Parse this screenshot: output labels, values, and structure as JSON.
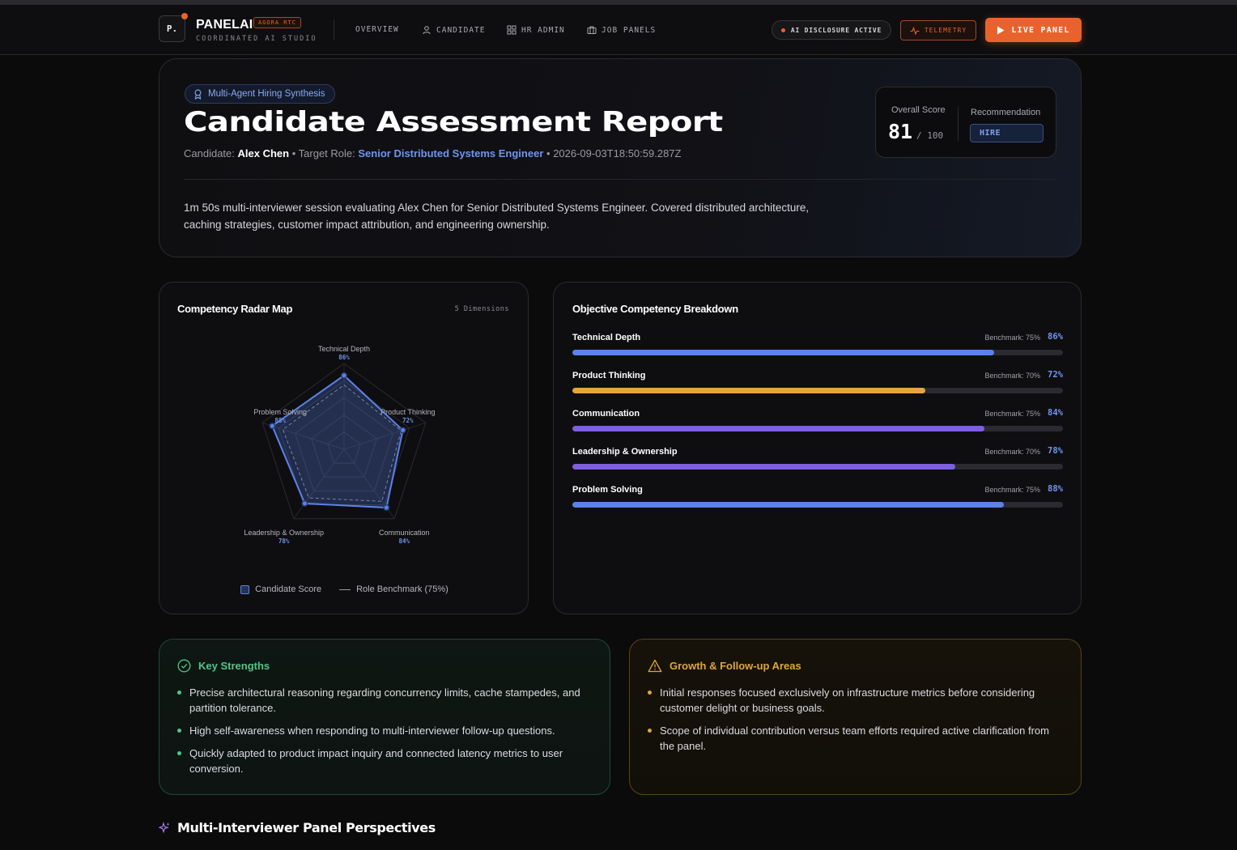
{
  "nav": {
    "logo": "P.",
    "brand": "PANELAI",
    "brand_badge": "AGORA RTC",
    "brand_sub": "COORDINATED AI STUDIO",
    "links": [
      "OVERVIEW",
      "CANDIDATE",
      "HR ADMIN",
      "JOB PANELS"
    ],
    "disclosure": "AI DISCLOSURE ACTIVE",
    "telemetry": "TELEMETRY",
    "live_panel": "LIVE PANEL",
    "accent": "#e8632c"
  },
  "hero": {
    "tag": "Multi-Agent Hiring Synthesis",
    "title": "Candidate Assessment Report",
    "candidate_label": "Candidate:",
    "candidate": "Alex Chen",
    "role_label": "Target Role:",
    "role": "Senior Distributed Systems Engineer",
    "timestamp": "2026-09-03T18:50:59.287Z",
    "summary": "1m 50s multi-interviewer session evaluating Alex Chen for Senior Distributed Systems Engineer. Covered distributed architecture, caching strategies, customer impact attribution, and engineering ownership.",
    "overall_score_label": "Overall Score",
    "overall_score": "81",
    "overall_score_max": "/ 100",
    "recommendation_label": "Recommendation",
    "recommendation": "HIRE"
  },
  "radar": {
    "title": "Competency Radar Map",
    "dimensions_label": "5 Dimensions",
    "legend_candidate": "Candidate Score",
    "legend_benchmark": "Role Benchmark (75%)"
  },
  "chart_data": {
    "type": "radar",
    "categories": [
      "Technical Depth",
      "Product Thinking",
      "Communication",
      "Leadership & Ownership",
      "Problem Solving"
    ],
    "series": [
      {
        "name": "Candidate Score",
        "values": [
          86,
          72,
          84,
          78,
          88
        ]
      },
      {
        "name": "Role Benchmark (75%)",
        "values": [
          75,
          70,
          75,
          70,
          75
        ]
      }
    ],
    "range": [
      0,
      100
    ]
  },
  "breakdown": {
    "title": "Objective Competency Breakdown",
    "bench_prefix": "Benchmark:",
    "rows": [
      {
        "name": "Technical Depth",
        "benchmark": "75%",
        "score": "86%",
        "value": 86,
        "color": "#5b82e8"
      },
      {
        "name": "Product Thinking",
        "benchmark": "70%",
        "score": "72%",
        "value": 72,
        "color": "#e8a43e"
      },
      {
        "name": "Communication",
        "benchmark": "75%",
        "score": "84%",
        "value": 84,
        "color": "#7d5fe0"
      },
      {
        "name": "Leadership & Ownership",
        "benchmark": "70%",
        "score": "78%",
        "value": 78,
        "color": "#7d5fe0"
      },
      {
        "name": "Problem Solving",
        "benchmark": "75%",
        "score": "88%",
        "value": 88,
        "color": "#5b82e8"
      }
    ]
  },
  "strengths": {
    "title": "Key Strengths",
    "items": [
      "Precise architectural reasoning regarding concurrency limits, cache stampedes, and partition tolerance.",
      "High self-awareness when responding to multi-interviewer follow-up questions.",
      "Quickly adapted to product impact inquiry and connected latency metrics to user conversion."
    ]
  },
  "growth": {
    "title": "Growth & Follow-up Areas",
    "items": [
      "Initial responses focused exclusively on infrastructure metrics before considering customer delight or business goals.",
      "Scope of individual contribution versus team efforts required active clarification from the panel."
    ]
  },
  "panel_perspectives": {
    "title": "Multi-Interviewer Panel Perspectives"
  }
}
